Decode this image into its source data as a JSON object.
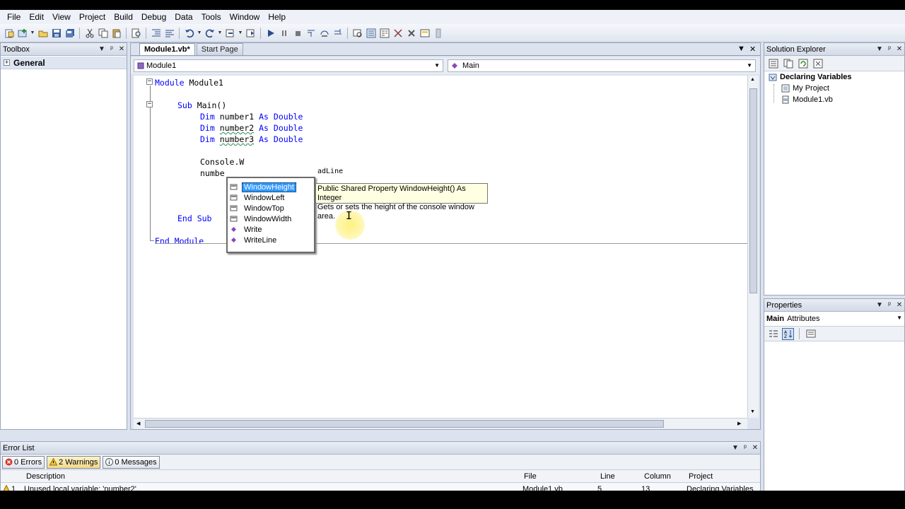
{
  "menubar": {
    "items": [
      "File",
      "Edit",
      "View",
      "Project",
      "Build",
      "Debug",
      "Data",
      "Tools",
      "Window",
      "Help"
    ]
  },
  "toolbox": {
    "title": "Toolbox",
    "group": "General"
  },
  "editor": {
    "tabs": [
      {
        "label": "Module1.vb*",
        "active": true
      },
      {
        "label": "Start Page",
        "active": false
      }
    ],
    "nav_left": "Module1",
    "nav_right": "Main",
    "code": {
      "line1_kw": "Module",
      "line1_name": " Module1",
      "sub_kw": "Sub",
      "sub_name": " Main()",
      "dim_kw": "Dim",
      "as_kw": "As",
      "type": "Double",
      "var1": "number1",
      "var2": "number2",
      "var3": "number3",
      "console_line": "Console.W",
      "number_partial": "numbe",
      "readline_partial": "adLine",
      "endsub": "End Sub",
      "endmodule_kw": "End Module"
    }
  },
  "intellisense": {
    "items": [
      "WindowHeight",
      "WindowLeft",
      "WindowTop",
      "WindowWidth",
      "Write",
      "WriteLine"
    ],
    "selected": 0,
    "tooltip_line1": "Public Shared Property WindowHeight() As Integer",
    "tooltip_line2": "Gets or sets the height of the console window area."
  },
  "solution_explorer": {
    "title": "Solution Explorer",
    "project": "Declaring Variables",
    "items": [
      "My Project",
      "Module1.vb"
    ]
  },
  "properties": {
    "title": "Properties",
    "object": "Main",
    "object_type": "Attributes"
  },
  "error_list": {
    "title": "Error List",
    "errors_btn": "0 Errors",
    "warnings_btn": "2 Warnings",
    "messages_btn": "0 Messages",
    "columns": {
      "description": "Description",
      "file": "File",
      "line": "Line",
      "column": "Column",
      "project": "Project"
    },
    "rows": [
      {
        "num": "1",
        "description": "Unused local variable: 'number2'.",
        "file": "Module1.vb",
        "line": "5",
        "column": "13",
        "project": "Declaring Variables"
      }
    ]
  },
  "colors": {
    "keyword": "#0000ff",
    "type": "#2b91af",
    "selection": "#3399ff",
    "tooltip_bg": "#ffffe1"
  }
}
